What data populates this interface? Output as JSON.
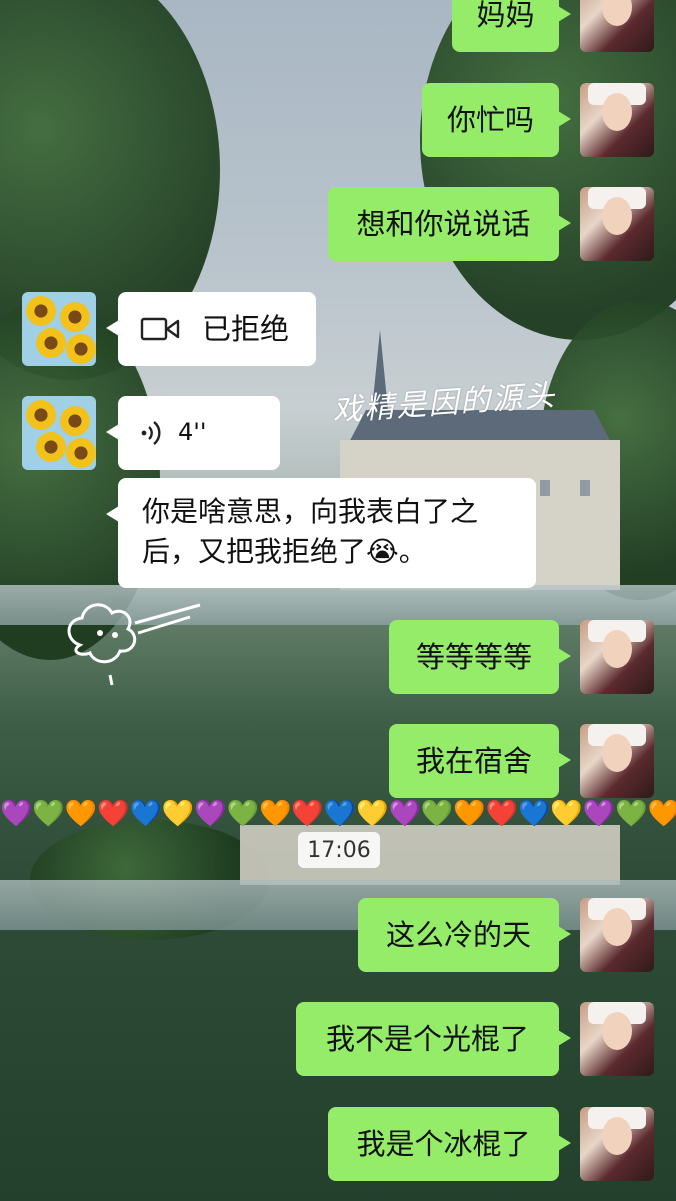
{
  "colors": {
    "outgoing_bubble": "#95ec69",
    "incoming_bubble": "#ffffff",
    "timestamp_pill": "#ffffff"
  },
  "messages": [
    {
      "from": "self",
      "text": "妈妈"
    },
    {
      "from": "self",
      "text": "你忙吗"
    },
    {
      "from": "self",
      "text": "想和你说说话"
    },
    {
      "from": "other",
      "type": "video-call",
      "icon": "video-camera-icon",
      "text": "已拒绝"
    },
    {
      "from": "other",
      "type": "voice",
      "icon": "voice-wave-icon",
      "text": "4''"
    },
    {
      "from": "other",
      "text": "你是啥意思，向我表白了之后，又把我拒绝了😭。",
      "line1": "你是啥意思，向我表白了之",
      "line2": "后，又把我拒绝了😭。"
    },
    {
      "from": "self",
      "text": "等等等等"
    },
    {
      "from": "self",
      "text": "我在宿舍"
    },
    {
      "from": "self",
      "text": "这么冷的天"
    },
    {
      "from": "self",
      "text": "我不是个光棍了"
    },
    {
      "from": "self",
      "text": "我是个冰棍了"
    }
  ],
  "timestamp": "17:06",
  "hearts": [
    "💜",
    "💚",
    "🧡",
    "❤️",
    "💙",
    "💛",
    "💜",
    "💚",
    "🧡",
    "❤️",
    "💙",
    "💛",
    "💜",
    "💚",
    "🧡",
    "❤️",
    "💙",
    "💛",
    "💜",
    "💚",
    "🧡",
    "❤️",
    "💙",
    "💛"
  ],
  "overlay_caption": "戏精是因的源头"
}
